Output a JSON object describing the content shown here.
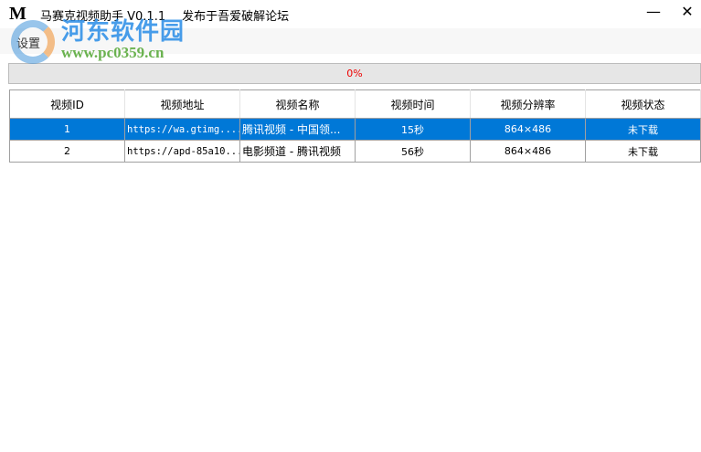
{
  "window": {
    "logo": "M",
    "title": "马赛克视频助手 V0.1.1",
    "subtitle": "发布于吾爱破解论坛",
    "minimize": "—",
    "close": "✕"
  },
  "menu": {
    "items": [
      {
        "label": "设置"
      }
    ]
  },
  "progress": {
    "value": 0,
    "label": "0%"
  },
  "table": {
    "headers": [
      "视频ID",
      "视频地址",
      "视频名称",
      "视频时间",
      "视频分辨率",
      "视频状态"
    ],
    "rows": [
      {
        "id": "1",
        "url": "https://wa.gtimg....",
        "name": "腾讯视频 - 中国领...",
        "duration": "15秒",
        "resolution": "864×486",
        "status": "未下载",
        "selected": true
      },
      {
        "id": "2",
        "url": "https://apd-85a10...",
        "name": "电影频道 - 腾讯视频",
        "duration": "56秒",
        "resolution": "864×486",
        "status": "未下载",
        "selected": false
      }
    ]
  },
  "watermark": {
    "name": "河东软件园",
    "url": "www.pc0359.cn"
  },
  "colors": {
    "selection": "#0078d7",
    "progress_text": "#ee0000"
  }
}
